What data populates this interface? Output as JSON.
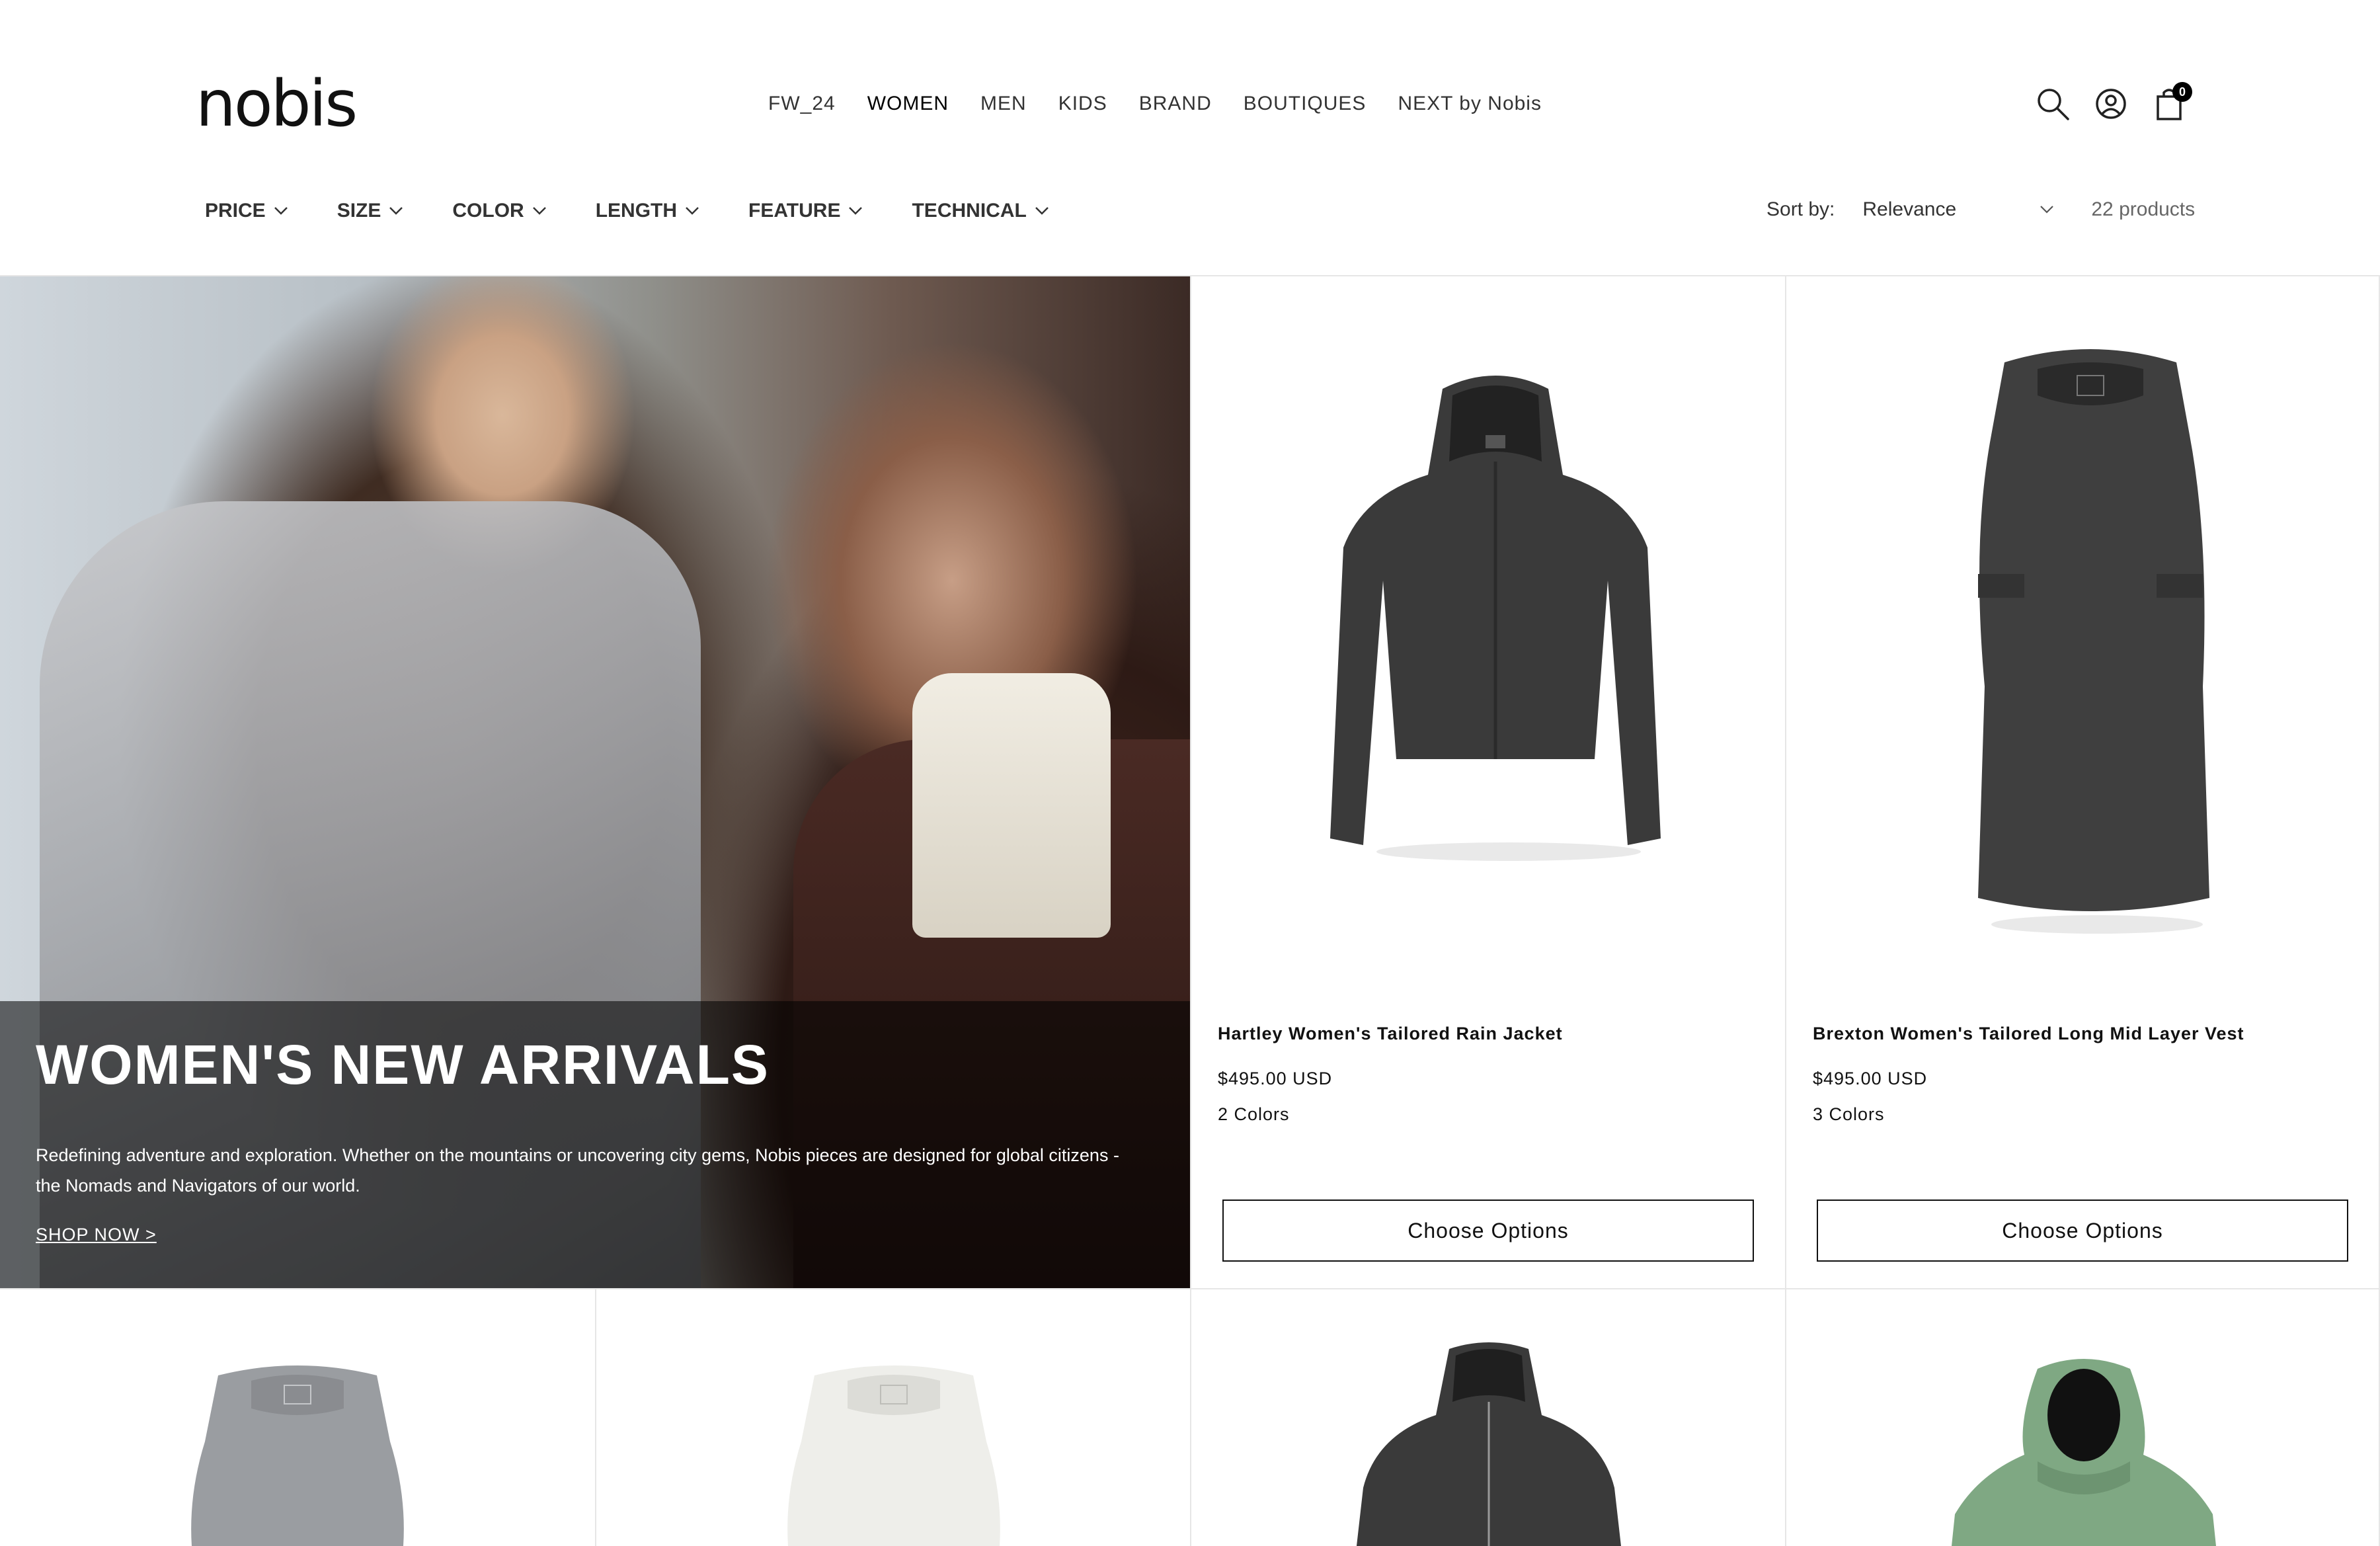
{
  "brand": {
    "logo": "nobis"
  },
  "nav": {
    "items": [
      {
        "label": "FW_24",
        "active": false
      },
      {
        "label": "WOMEN",
        "active": true
      },
      {
        "label": "MEN",
        "active": false
      },
      {
        "label": "KIDS",
        "active": false
      },
      {
        "label": "BRAND",
        "active": false
      },
      {
        "label": "BOUTIQUES",
        "active": false
      },
      {
        "label": "NEXT by Nobis",
        "active": false
      }
    ]
  },
  "header_icons": {
    "search": "search-icon",
    "account": "user-icon",
    "cart": "bag-icon",
    "cart_count": "0"
  },
  "filters": {
    "items": [
      {
        "label": "PRICE"
      },
      {
        "label": "SIZE"
      },
      {
        "label": "COLOR"
      },
      {
        "label": "LENGTH"
      },
      {
        "label": "FEATURE"
      },
      {
        "label": "TECHNICAL"
      }
    ]
  },
  "sort": {
    "label": "Sort by:",
    "selected": "Relevance",
    "count": "22 products"
  },
  "hero": {
    "title": "WOMEN'S NEW ARRIVALS",
    "text": "Redefining adventure and exploration. Whether on the mountains or uncovering city gems, Nobis pieces are designed for global citizens - the Nomads and Navigators of our world.",
    "link": "SHOP NOW >"
  },
  "products": [
    {
      "name": "Hartley Women's Tailored Rain Jacket",
      "price": "$495.00 USD",
      "colors": "2 Colors",
      "button": "Choose Options",
      "color": "#3a3a3a",
      "icon": "rain-jacket-image"
    },
    {
      "name": "Brexton Women's Tailored Long Mid Layer Vest",
      "price": "$495.00 USD",
      "colors": "3 Colors",
      "button": "Choose Options",
      "color": "#3f3f3f",
      "icon": "long-vest-image"
    }
  ],
  "second_row": [
    {
      "icon": "grey-vest-image",
      "color": "#9a9da1"
    },
    {
      "icon": "white-vest-image",
      "color": "#eeeeea"
    },
    {
      "icon": "black-jacket-image",
      "color": "#3a3a3a"
    },
    {
      "icon": "green-jacket-image",
      "color": "#7fa883"
    }
  ]
}
